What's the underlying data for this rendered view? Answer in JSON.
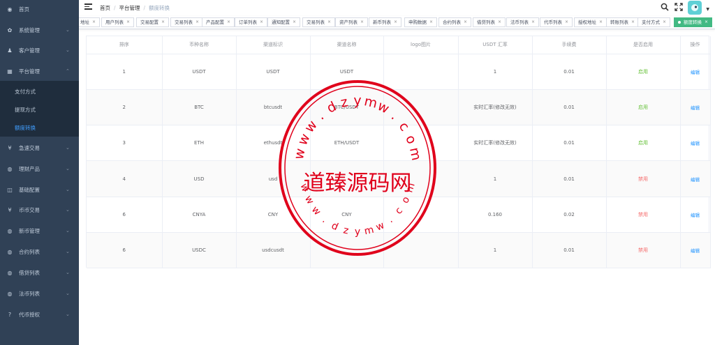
{
  "sidebar": {
    "items": [
      {
        "label": "首页",
        "icon": "dashboard-icon",
        "glyph": "◉",
        "has_arrow": false
      },
      {
        "label": "系统管理",
        "icon": "gear-icon",
        "glyph": "✿",
        "has_arrow": true
      },
      {
        "label": "客户管理",
        "icon": "user-icon",
        "glyph": "♟",
        "has_arrow": true
      },
      {
        "label": "平台管理",
        "icon": "grid-icon",
        "glyph": "▦",
        "has_arrow": true,
        "expanded": true
      },
      {
        "label": "急速交易",
        "icon": "yen-icon",
        "glyph": "¥",
        "has_arrow": true
      },
      {
        "label": "理财产品",
        "icon": "circle-icon",
        "glyph": "◍",
        "has_arrow": true
      },
      {
        "label": "基础配置",
        "icon": "columns-icon",
        "glyph": "◫",
        "has_arrow": true
      },
      {
        "label": "币币交易",
        "icon": "yen-icon",
        "glyph": "¥",
        "has_arrow": true
      },
      {
        "label": "新币管理",
        "icon": "circle-icon",
        "glyph": "◍",
        "has_arrow": true
      },
      {
        "label": "合约列表",
        "icon": "circle-icon",
        "glyph": "◍",
        "has_arrow": true
      },
      {
        "label": "借贷列表",
        "icon": "circle-icon",
        "glyph": "◍",
        "has_arrow": true
      },
      {
        "label": "法币列表",
        "icon": "circle-icon",
        "glyph": "◍",
        "has_arrow": true
      },
      {
        "label": "代币授权",
        "icon": "question-icon",
        "glyph": "?",
        "has_arrow": true
      }
    ],
    "submenu": [
      {
        "label": "支付方式",
        "active": false
      },
      {
        "label": "提现方式",
        "active": false
      },
      {
        "label": "额度转换",
        "active": true
      }
    ]
  },
  "header": {
    "breadcrumb": [
      "首页",
      "平台管理",
      "额度转换"
    ]
  },
  "tags": [
    {
      "label": "地址",
      "active": false
    },
    {
      "label": "用户列表",
      "active": false
    },
    {
      "label": "交易配置",
      "active": false
    },
    {
      "label": "交易列表",
      "active": false
    },
    {
      "label": "产品配置",
      "active": false
    },
    {
      "label": "订单列表",
      "active": false
    },
    {
      "label": "通知配置",
      "active": false
    },
    {
      "label": "交易列表",
      "active": false
    },
    {
      "label": "资产列表",
      "active": false
    },
    {
      "label": "新币列表",
      "active": false
    },
    {
      "label": "申购数据",
      "active": false
    },
    {
      "label": "合约列表",
      "active": false
    },
    {
      "label": "借贷列表",
      "active": false
    },
    {
      "label": "法币列表",
      "active": false
    },
    {
      "label": "代币列表",
      "active": false
    },
    {
      "label": "授权地址",
      "active": false
    },
    {
      "label": "转账列表",
      "active": false
    },
    {
      "label": "支付方式",
      "active": false
    },
    {
      "label": "额度转换",
      "active": true
    }
  ],
  "table": {
    "columns": [
      "排序",
      "币种名称",
      "渠道标识",
      "渠道名称",
      "logo图片",
      "USDT 汇率",
      "手续费",
      "是否启用",
      "操作"
    ],
    "rows": [
      {
        "sort": "1",
        "coin": "USDT",
        "channel_id": "USDT",
        "channel_name": "USDT",
        "logo": "",
        "rate": "1",
        "fee": "0.01",
        "status": "启用",
        "enabled": true,
        "action": "编辑"
      },
      {
        "sort": "2",
        "coin": "BTC",
        "channel_id": "btcusdt",
        "channel_name": "BTC/USDT",
        "logo": "",
        "rate": "实时汇率(修改无效)",
        "fee": "0.01",
        "status": "启用",
        "enabled": true,
        "action": "编辑"
      },
      {
        "sort": "3",
        "coin": "ETH",
        "channel_id": "ethusdt",
        "channel_name": "ETH/USDT",
        "logo": "",
        "rate": "实时汇率(修改无效)",
        "fee": "0.01",
        "status": "启用",
        "enabled": true,
        "action": "编辑"
      },
      {
        "sort": "4",
        "coin": "USD",
        "channel_id": "usd",
        "channel_name": "",
        "logo": "",
        "rate": "1",
        "fee": "0.01",
        "status": "禁用",
        "enabled": false,
        "action": "编辑"
      },
      {
        "sort": "6",
        "coin": "CNYA",
        "channel_id": "CNY",
        "channel_name": "CNY",
        "logo": "",
        "rate": "0.160",
        "fee": "0.02",
        "status": "禁用",
        "enabled": false,
        "action": "编辑"
      },
      {
        "sort": "6",
        "coin": "USDC",
        "channel_id": "usdcusdt",
        "channel_name": "",
        "logo": "",
        "rate": "1",
        "fee": "0.01",
        "status": "禁用",
        "enabled": false,
        "action": "编辑"
      }
    ]
  },
  "watermark": {
    "center_text": "道臻源码网",
    "top_arc": "www.dzymw.com",
    "bottom_arc": "www.dzymw.com",
    "color": "#e0001b"
  },
  "colors": {
    "sidebar_bg": "#304156",
    "active": "#409eff",
    "tag_active": "#42b983",
    "enabled": "#67c23a",
    "disabled": "#f56c6c"
  }
}
